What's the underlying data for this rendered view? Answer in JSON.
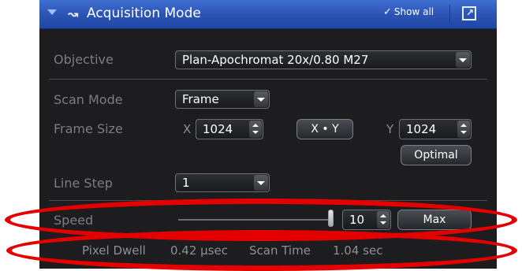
{
  "panel": {
    "title": "Acquisition Mode",
    "show_all_label": "Show all",
    "icons": {
      "collapse": "collapse-arrow-icon",
      "tool": "acquisition-mode-icon",
      "check": "check-icon",
      "popout": "popout-icon"
    }
  },
  "objective": {
    "label": "Objective",
    "value": "Plan-Apochromat 20x/0.80  M27"
  },
  "scan_mode": {
    "label": "Scan Mode",
    "value": "Frame"
  },
  "frame_size": {
    "label": "Frame Size",
    "x_label": "X",
    "x_value": "1024",
    "swap_label": "X • Y",
    "y_label": "Y",
    "y_value": "1024",
    "optimal_label": "Optimal"
  },
  "line_step": {
    "label": "Line Step",
    "value": "1"
  },
  "speed": {
    "label": "Speed",
    "value": "10",
    "max_label": "Max",
    "slider_fraction": 1.0
  },
  "info": {
    "pixel_dwell_label": "Pixel Dwell",
    "pixel_dwell_value": "0.42 µsec",
    "scan_time_label": "Scan Time",
    "scan_time_value": "1.04 sec"
  },
  "colors": {
    "panel_bg": "#1d1d1f",
    "titlebar": "#2a53b3",
    "annotation": "#e50000"
  }
}
